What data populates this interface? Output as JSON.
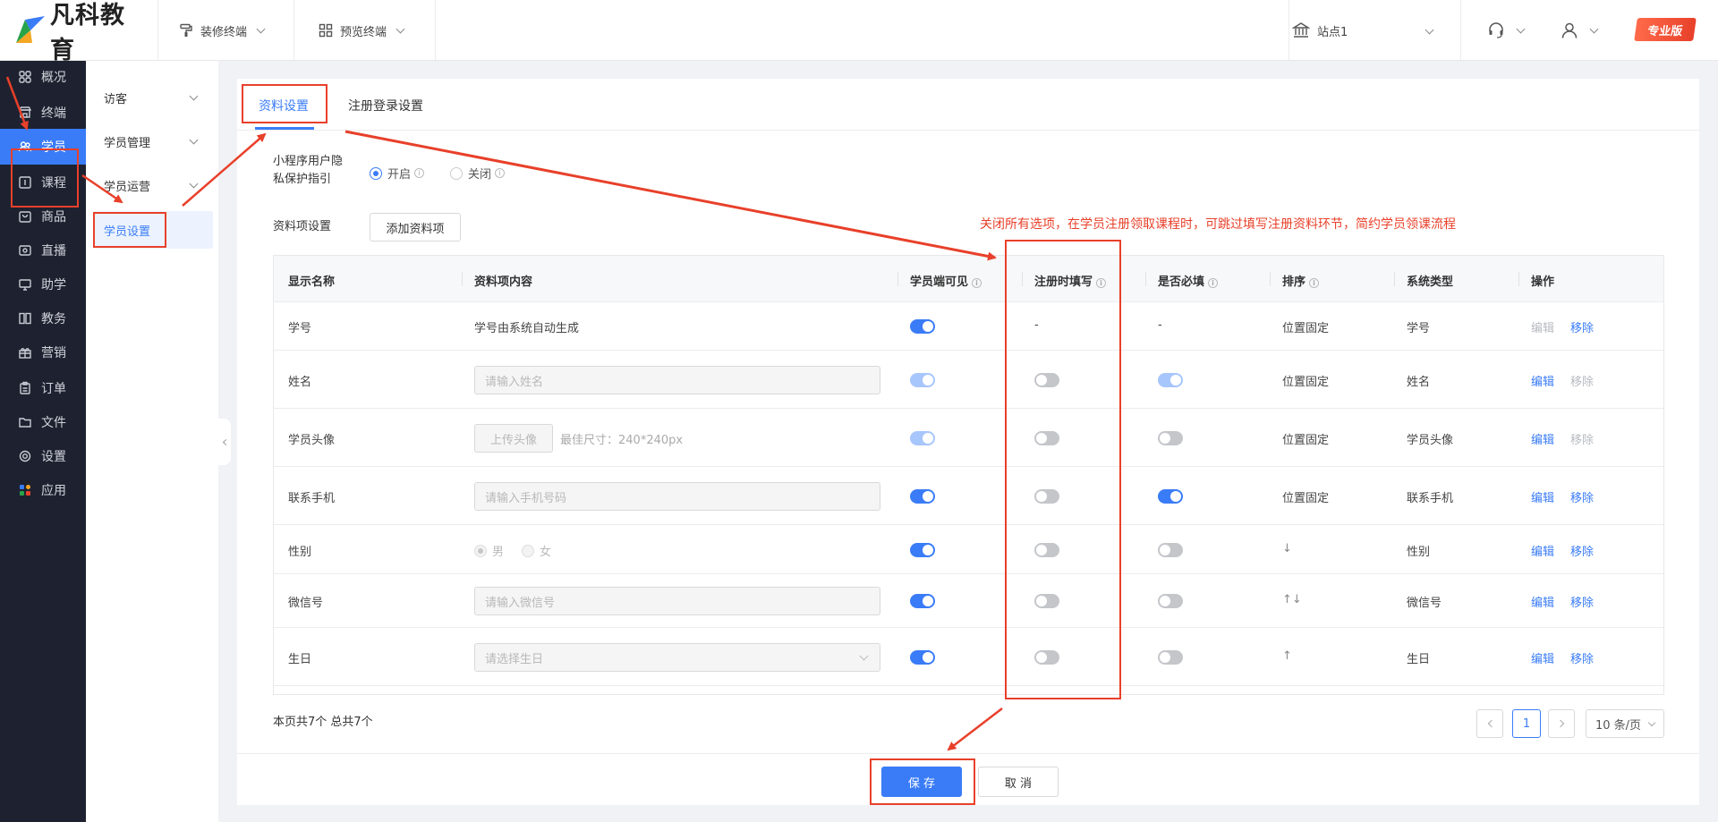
{
  "brand": {
    "name": "凡科教育",
    "badge": "专业版"
  },
  "topbar": {
    "decorate": "装修终端",
    "preview": "预览终端",
    "site": "站点1"
  },
  "nav1": [
    {
      "label": "概况",
      "icon": "grid-icon"
    },
    {
      "label": "终端",
      "icon": "store-icon"
    },
    {
      "label": "学员",
      "icon": "users-icon",
      "active": true
    },
    {
      "label": "课程",
      "icon": "course-icon"
    },
    {
      "label": "商品",
      "icon": "bag-icon"
    },
    {
      "label": "直播",
      "icon": "live-icon"
    },
    {
      "label": "助学",
      "icon": "screen-icon"
    },
    {
      "label": "教务",
      "icon": "book-icon"
    },
    {
      "label": "营销",
      "icon": "gift-icon"
    },
    {
      "label": "订单",
      "icon": "clipboard-icon"
    },
    {
      "label": "文件",
      "icon": "folder-icon"
    },
    {
      "label": "设置",
      "icon": "gear-icon"
    },
    {
      "label": "应用",
      "icon": "apps-icon"
    }
  ],
  "nav2": [
    {
      "label": "访客"
    },
    {
      "label": "学员管理"
    },
    {
      "label": "学员运营"
    },
    {
      "label": "学员设置",
      "active": true
    }
  ],
  "tabs": [
    {
      "label": "资料设置",
      "active": true
    },
    {
      "label": "注册登录设置"
    }
  ],
  "privacy": {
    "label_line1": "小程序用户隐",
    "label_line2": "私保护指引",
    "on": "开启",
    "off": "关闭",
    "selected": "on"
  },
  "fields": {
    "label": "资料项设置",
    "add_button": "添加资料项"
  },
  "annotation": "关闭所有选项，在学员注册领取课程时，可跳过填写注册资料环节，简约学员领课流程",
  "table": {
    "headers": [
      "显示名称",
      "资料项内容",
      "学员端可见",
      "注册时填写",
      "是否必填",
      "排序",
      "系统类型",
      "操作"
    ],
    "rows": [
      {
        "name": "学号",
        "content": "学号由系统自动生成",
        "visible": "on",
        "register": "-",
        "required": "-",
        "sort": "位置固定",
        "type": "学号",
        "edit": "编辑",
        "remove": "移除"
      },
      {
        "name": "姓名",
        "placeholder": "请输入姓名",
        "visible": "dis",
        "register": "off",
        "required": "dis",
        "sort": "位置固定",
        "type": "姓名",
        "edit": "编辑",
        "remove": "移除"
      },
      {
        "name": "学员头像",
        "upload": "上传头像",
        "hint": "最佳尺寸：240*240px",
        "visible": "dis",
        "register": "off",
        "required": "off",
        "sort": "位置固定",
        "type": "学员头像",
        "edit": "编辑",
        "remove": "移除"
      },
      {
        "name": "联系手机",
        "placeholder": "请输入手机号码",
        "visible": "on",
        "register": "off",
        "required": "on",
        "sort": "位置固定",
        "type": "联系手机",
        "edit": "编辑",
        "remove": "移除"
      },
      {
        "name": "性别",
        "male": "男",
        "female": "女",
        "visible": "on",
        "register": "off",
        "required": "off",
        "sort": "↓",
        "type": "性别",
        "edit": "编辑",
        "remove": "移除"
      },
      {
        "name": "微信号",
        "placeholder": "请输入微信号",
        "visible": "on",
        "register": "off",
        "required": "off",
        "sort": "↑↓",
        "type": "微信号",
        "edit": "编辑",
        "remove": "移除"
      },
      {
        "name": "生日",
        "placeholder": "请选择生日",
        "visible": "on",
        "register": "off",
        "required": "off",
        "sort": "↑",
        "type": "生日",
        "edit": "编辑",
        "remove": "移除"
      }
    ]
  },
  "pagination": {
    "summary": "本页共7个 总共7个",
    "current": "1",
    "page_size": "10 条/页"
  },
  "actions": {
    "save": "保 存",
    "cancel": "取 消"
  },
  "colors": {
    "primary": "#3a7cf7",
    "annotation": "#e8402a",
    "sidebar": "#1e2230"
  }
}
